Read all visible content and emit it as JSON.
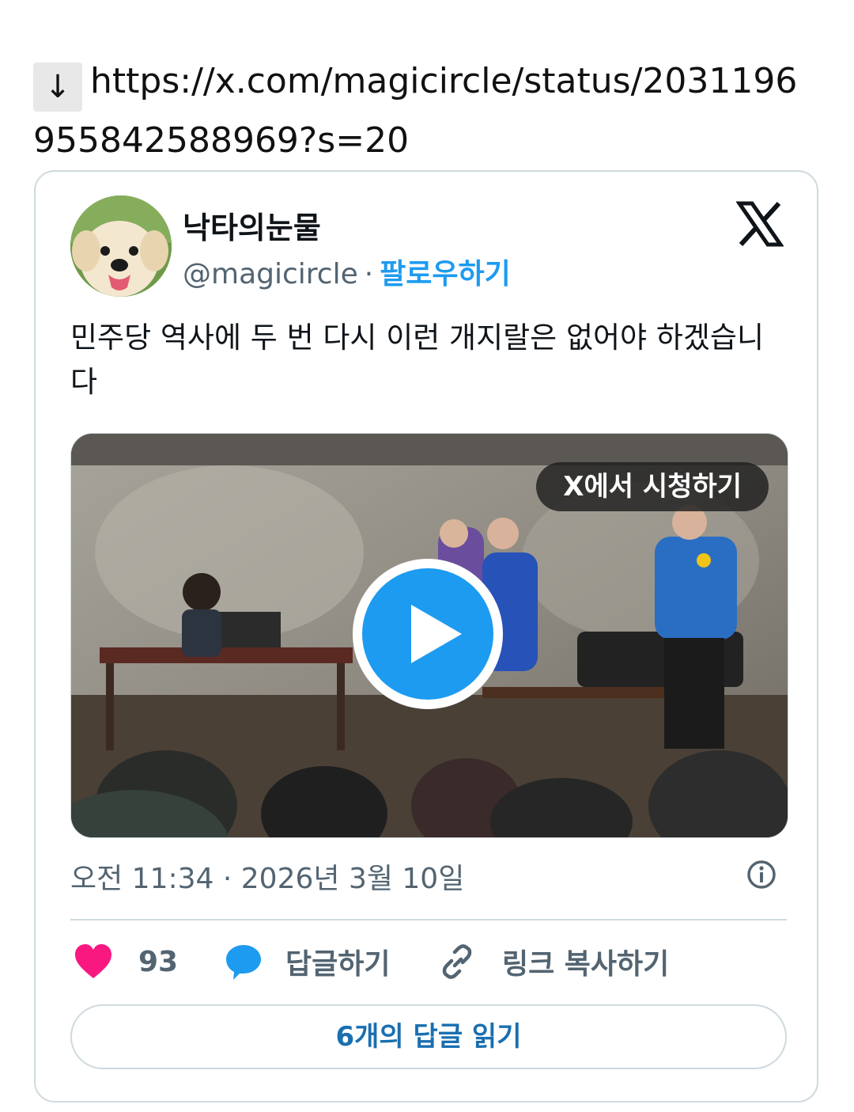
{
  "url_line": {
    "arrow_icon": "↓",
    "url": "https://x.com/magicircle/status/2031196955842588969?s=20"
  },
  "tweet": {
    "display_name": "낙타의눈물",
    "handle": "@magicircle",
    "separator": "·",
    "follow_label": "팔로우하기",
    "text": "민주당 역사에 두 번 다시 이런 개지랄은 없어야 하겠습니다",
    "media": {
      "watch_label": "X에서 시청하기",
      "play_icon": "play-icon"
    },
    "timestamp": "오전 11:34 · 2026년 3월 10일",
    "info_icon": "info-icon",
    "actions": {
      "like_count": "93",
      "reply_label": "답글하기",
      "copy_link_label": "링크 복사하기"
    },
    "read_replies_label": "6개의 답글 읽기"
  },
  "colors": {
    "accent": "#1d9bf0",
    "like": "#f91880",
    "secondary_text": "#536471",
    "border": "#cfd9de"
  }
}
